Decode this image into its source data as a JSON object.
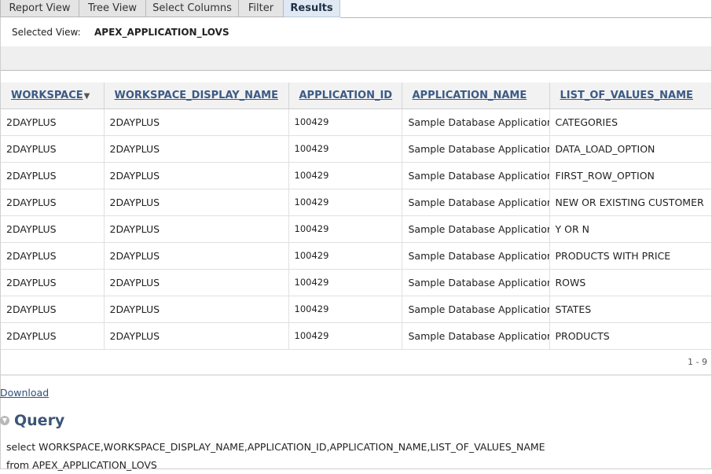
{
  "tabs": [
    {
      "label": "Report View"
    },
    {
      "label": "Tree View"
    },
    {
      "label": "Select Columns"
    },
    {
      "label": "Filter"
    },
    {
      "label": "Results",
      "active": true
    }
  ],
  "selected_view": {
    "label": "Selected View:",
    "value": "APEX_APPLICATION_LOVS"
  },
  "table": {
    "columns": [
      "WORKSPACE",
      "WORKSPACE_DISPLAY_NAME",
      "APPLICATION_ID",
      "APPLICATION_NAME",
      "LIST_OF_VALUES_NAME"
    ],
    "sort_icon": "▼",
    "rows": [
      [
        "2DAYPLUS",
        "2DAYPLUS",
        "100429",
        "Sample Database Application",
        "CATEGORIES"
      ],
      [
        "2DAYPLUS",
        "2DAYPLUS",
        "100429",
        "Sample Database Application",
        "DATA_LOAD_OPTION"
      ],
      [
        "2DAYPLUS",
        "2DAYPLUS",
        "100429",
        "Sample Database Application",
        "FIRST_ROW_OPTION"
      ],
      [
        "2DAYPLUS",
        "2DAYPLUS",
        "100429",
        "Sample Database Application",
        "NEW OR EXISTING CUSTOMER"
      ],
      [
        "2DAYPLUS",
        "2DAYPLUS",
        "100429",
        "Sample Database Application",
        "Y OR N"
      ],
      [
        "2DAYPLUS",
        "2DAYPLUS",
        "100429",
        "Sample Database Application",
        "PRODUCTS WITH PRICE"
      ],
      [
        "2DAYPLUS",
        "2DAYPLUS",
        "100429",
        "Sample Database Application",
        "ROWS"
      ],
      [
        "2DAYPLUS",
        "2DAYPLUS",
        "100429",
        "Sample Database Application",
        "STATES"
      ],
      [
        "2DAYPLUS",
        "2DAYPLUS",
        "100429",
        "Sample Database Application",
        "PRODUCTS"
      ]
    ]
  },
  "pagination": "1 - 9",
  "download_label": "Download",
  "query": {
    "title": "Query",
    "toggle_icon": "collapse-chevron-icon",
    "sql_line1": "select WORKSPACE,WORKSPACE_DISPLAY_NAME,APPLICATION_ID,APPLICATION_NAME,LIST_OF_VALUES_NAME",
    "sql_line2": "from APEX_APPLICATION_LOVS"
  },
  "colors": {
    "link": "#3b5a85",
    "active_tab": "#dfe8f3",
    "header_bg": "#f2f2f2"
  }
}
